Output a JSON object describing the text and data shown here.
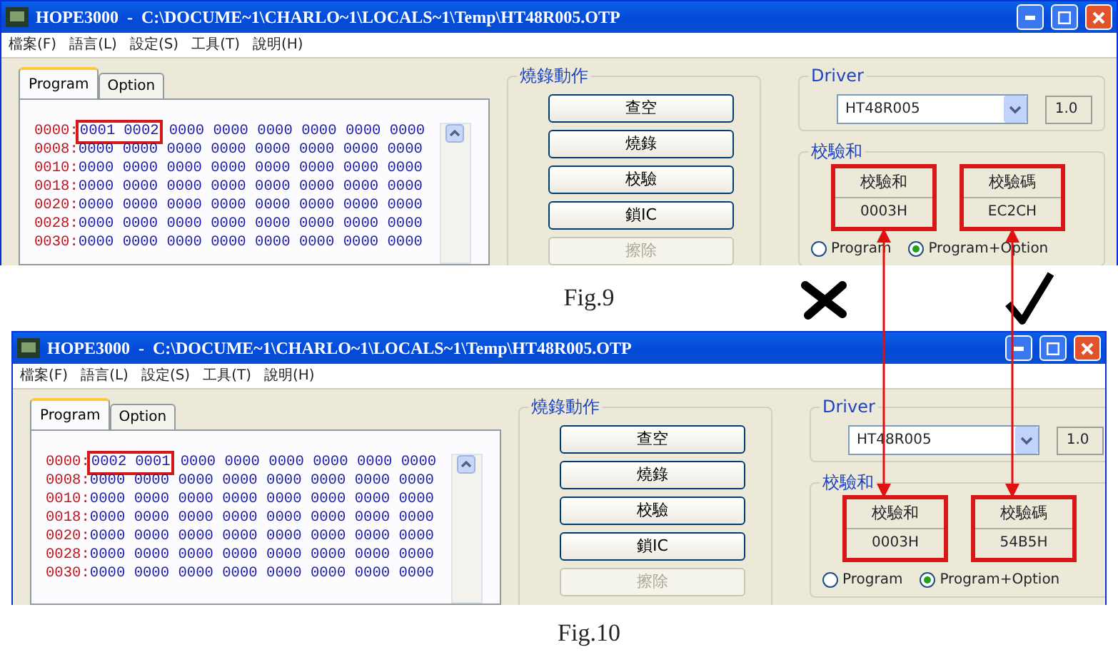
{
  "figures": [
    {
      "window": {
        "title": "HOPE3000  -  C:\\DOCUME~1\\CHARLO~1\\LOCALS~1\\Temp\\HT48R005.OTP",
        "menu": [
          "檔案(F)",
          "語言(L)",
          "設定(S)",
          "工具(T)",
          "說明(H)"
        ],
        "tabs": [
          {
            "label": "Program",
            "selected": true
          },
          {
            "label": "Option",
            "selected": false
          }
        ],
        "memory_rows": [
          {
            "address": "0000:",
            "marked": [
              "0001",
              "0002"
            ],
            "words": [
              "0000",
              "0000",
              "0000",
              "0000",
              "0000",
              "0000"
            ]
          },
          {
            "address": "0008:",
            "words": [
              "0000",
              "0000",
              "0000",
              "0000",
              "0000",
              "0000",
              "0000",
              "0000"
            ]
          },
          {
            "address": "0010:",
            "words": [
              "0000",
              "0000",
              "0000",
              "0000",
              "0000",
              "0000",
              "0000",
              "0000"
            ]
          },
          {
            "address": "0018:",
            "words": [
              "0000",
              "0000",
              "0000",
              "0000",
              "0000",
              "0000",
              "0000",
              "0000"
            ]
          },
          {
            "address": "0020:",
            "words": [
              "0000",
              "0000",
              "0000",
              "0000",
              "0000",
              "0000",
              "0000",
              "0000"
            ]
          },
          {
            "address": "0028:",
            "words": [
              "0000",
              "0000",
              "0000",
              "0000",
              "0000",
              "0000",
              "0000",
              "0000"
            ]
          },
          {
            "address": "0030:",
            "words": [
              "0000",
              "0000",
              "0000",
              "0000",
              "0000",
              "0000",
              "0000",
              "0000"
            ]
          }
        ],
        "burn_actions": {
          "title": "燒錄動作",
          "buttons": [
            {
              "label": "查空",
              "disabled": false
            },
            {
              "label": "燒錄",
              "disabled": false
            },
            {
              "label": "校驗",
              "disabled": false
            },
            {
              "label": "鎖IC",
              "disabled": false
            },
            {
              "label": "擦除",
              "disabled": true
            }
          ]
        },
        "driver": {
          "title": "Driver",
          "value": "HT48R005",
          "version": "1.0"
        },
        "checksum": {
          "title": "校驗和",
          "sum_label": "校驗和",
          "sum_value": "0003H",
          "code_label": "校驗碼",
          "code_value": "EC2CH",
          "options": [
            {
              "label": "Program",
              "selected": false
            },
            {
              "label": "Program+Option",
              "selected": true
            }
          ]
        }
      },
      "caption": "Fig.9"
    },
    {
      "window": {
        "title": "HOPE3000  -  C:\\DOCUME~1\\CHARLO~1\\LOCALS~1\\Temp\\HT48R005.OTP",
        "menu": [
          "檔案(F)",
          "語言(L)",
          "設定(S)",
          "工具(T)",
          "說明(H)"
        ],
        "tabs": [
          {
            "label": "Program",
            "selected": true
          },
          {
            "label": "Option",
            "selected": false
          }
        ],
        "memory_rows": [
          {
            "address": "0000:",
            "marked": [
              "0002",
              "0001"
            ],
            "words": [
              "0000",
              "0000",
              "0000",
              "0000",
              "0000",
              "0000"
            ]
          },
          {
            "address": "0008:",
            "words": [
              "0000",
              "0000",
              "0000",
              "0000",
              "0000",
              "0000",
              "0000",
              "0000"
            ]
          },
          {
            "address": "0010:",
            "words": [
              "0000",
              "0000",
              "0000",
              "0000",
              "0000",
              "0000",
              "0000",
              "0000"
            ]
          },
          {
            "address": "0018:",
            "words": [
              "0000",
              "0000",
              "0000",
              "0000",
              "0000",
              "0000",
              "0000",
              "0000"
            ]
          },
          {
            "address": "0020:",
            "words": [
              "0000",
              "0000",
              "0000",
              "0000",
              "0000",
              "0000",
              "0000",
              "0000"
            ]
          },
          {
            "address": "0028:",
            "words": [
              "0000",
              "0000",
              "0000",
              "0000",
              "0000",
              "0000",
              "0000",
              "0000"
            ]
          },
          {
            "address": "0030:",
            "words": [
              "0000",
              "0000",
              "0000",
              "0000",
              "0000",
              "0000",
              "0000",
              "0000"
            ]
          }
        ],
        "burn_actions": {
          "title": "燒錄動作",
          "buttons": [
            {
              "label": "查空",
              "disabled": false
            },
            {
              "label": "燒錄",
              "disabled": false
            },
            {
              "label": "校驗",
              "disabled": false
            },
            {
              "label": "鎖IC",
              "disabled": false
            },
            {
              "label": "擦除",
              "disabled": true
            }
          ]
        },
        "driver": {
          "title": "Driver",
          "value": "HT48R005",
          "version": "1.0"
        },
        "checksum": {
          "title": "校驗和",
          "sum_label": "校驗和",
          "sum_value": "0003H",
          "code_label": "校驗碼",
          "code_value": "54B5H",
          "options": [
            {
              "label": "Program",
              "selected": false
            },
            {
              "label": "Program+Option",
              "selected": true
            }
          ]
        }
      },
      "caption": "Fig.10"
    }
  ],
  "verdicts": [
    {
      "kind": "cross"
    },
    {
      "kind": "check"
    }
  ]
}
